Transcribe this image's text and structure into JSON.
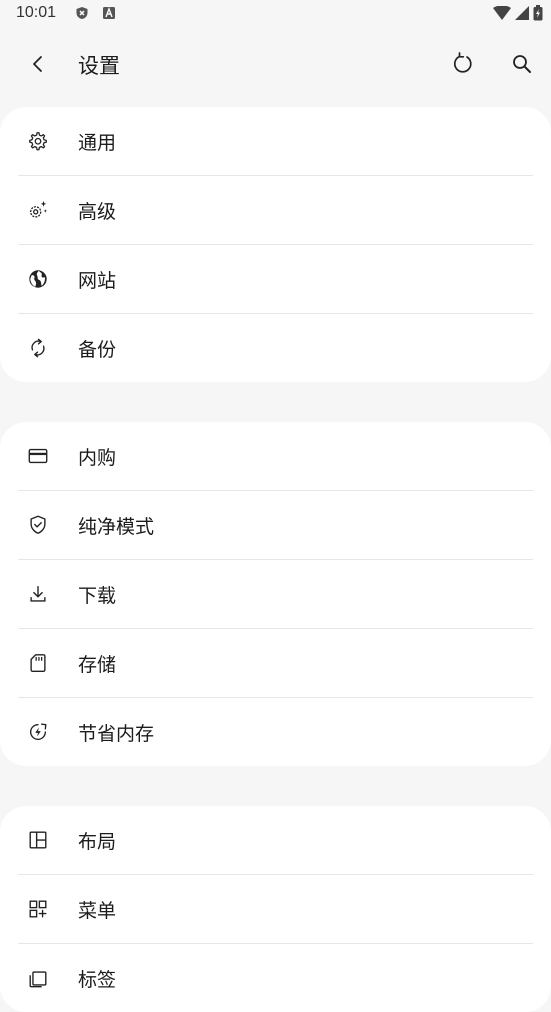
{
  "status": {
    "time": "10:01"
  },
  "header": {
    "title": "设置"
  },
  "groups": [
    {
      "items": [
        {
          "label": "通用",
          "icon": "gear-icon"
        },
        {
          "label": "高级",
          "icon": "gear-sparkle-icon"
        },
        {
          "label": "网站",
          "icon": "globe-icon"
        },
        {
          "label": "备份",
          "icon": "sync-icon"
        }
      ]
    },
    {
      "items": [
        {
          "label": "内购",
          "icon": "credit-card-icon"
        },
        {
          "label": "纯净模式",
          "icon": "shield-check-icon"
        },
        {
          "label": "下载",
          "icon": "download-icon"
        },
        {
          "label": "存储",
          "icon": "sd-card-icon"
        },
        {
          "label": "节省内存",
          "icon": "memory-saver-icon"
        }
      ]
    },
    {
      "items": [
        {
          "label": "布局",
          "icon": "layout-icon"
        },
        {
          "label": "菜单",
          "icon": "apps-add-icon"
        },
        {
          "label": "标签",
          "icon": "tabs-icon"
        }
      ]
    }
  ],
  "colors": {
    "background": "#f6f6f6",
    "card": "#ffffff",
    "divider": "#e6e6e6",
    "text": "#1c1c1c"
  }
}
